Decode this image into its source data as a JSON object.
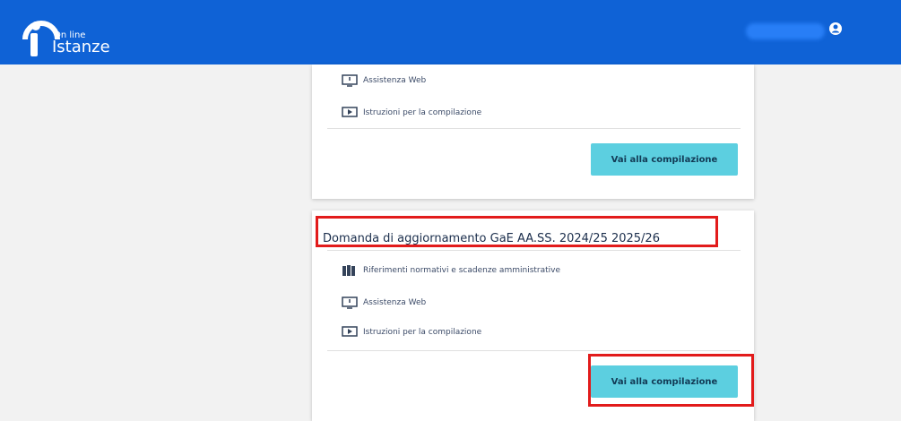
{
  "header": {
    "logo_online": "On line",
    "logo_istanze": "Istanze"
  },
  "cards": {
    "first": {
      "links": [
        "Assistenza Web",
        "Istruzioni per la compilazione"
      ],
      "button_label": "Vai alla compilazione"
    },
    "second": {
      "title": "Domanda di aggiornamento GaE AA.SS. 2024/25 2025/26",
      "links": [
        "Riferimenti normativi e scadenze amministrative",
        "Assistenza Web",
        "Istruzioni per la compilazione"
      ],
      "button_label": "Vai alla compilazione"
    }
  },
  "colors": {
    "header": "#0f62d6",
    "button": "#5ccfe0",
    "highlight": "#e21b1b"
  },
  "icons": {
    "help": "monitor-help-icon",
    "instructions": "monitor-play-icon",
    "law": "law-books-icon",
    "user": "user-icon"
  }
}
